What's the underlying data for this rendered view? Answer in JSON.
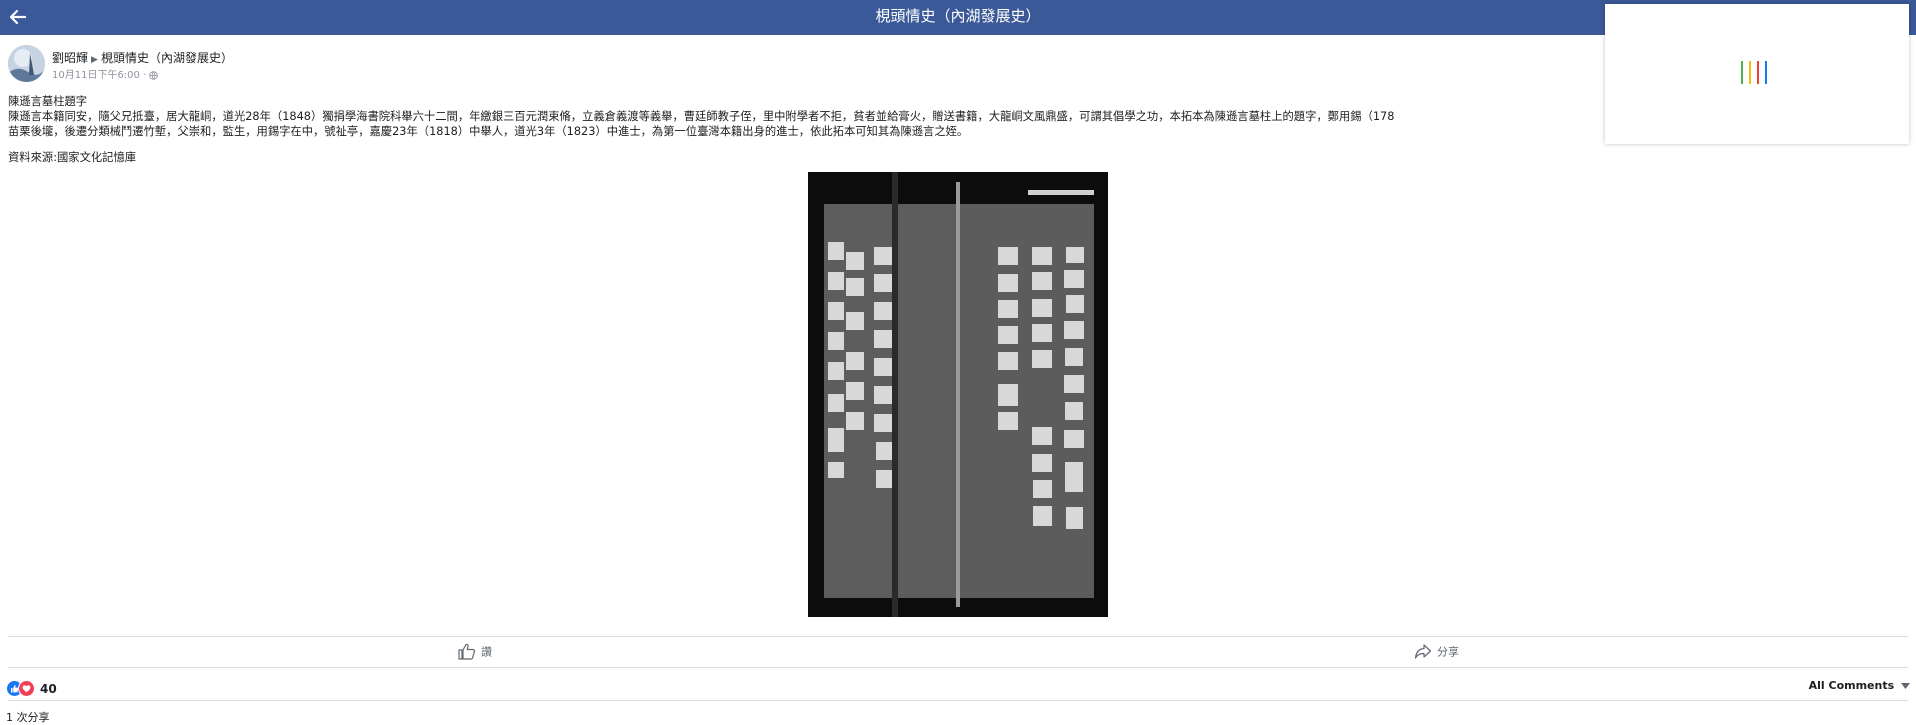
{
  "header": {
    "title": "梘頭情史（內湖發展史）",
    "back_icon": "arrow-left-icon"
  },
  "post": {
    "author": "劉昭輝",
    "group": "梘頭情史（內湖發展史）",
    "timestamp": "10月11日下午6:00",
    "privacy_icon": "globe-icon",
    "text_lines": [
      "陳遜言墓柱題字",
      "陳遜言本籍同安，隨父兄抵臺，居大龍峒，道光28年（1848）獨捐學海書院科舉六十二間，年繳銀三百元潤束脩，立義倉義渡等義舉，曹廷師教子侄，里中附學者不拒，貧者並給膏火，贈送書籍，大龍峒文風鼎盛，可謂其倡學之功，本拓本為陳遜言墓柱上的題字，鄭用錫（178",
      "苗栗後壠，後遷分類械鬥遷竹塹，父崇和，監生，用錫字在中，號祉亭，嘉慶23年（1818）中舉人，道光3年（1823）中進士，為第一位臺灣本籍出身的進士，依此拓本可知其為陳遜言之姪。"
    ],
    "source": "資料來源:國家文化記憶庫"
  },
  "actions": {
    "like_label": "讚",
    "share_label": "分享"
  },
  "stats": {
    "reaction_count": "40",
    "comments_sort": "All Comments",
    "share_count": "1 次分享"
  },
  "colors": {
    "header_bg": "#3b5998",
    "like_blue": "#1877f2",
    "love_red": "#f33e58",
    "loader_colors": [
      "#4caf50",
      "#fbbc05",
      "#ea4335",
      "#1877f2"
    ]
  }
}
